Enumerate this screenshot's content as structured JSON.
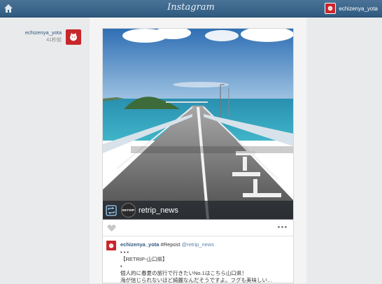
{
  "header": {
    "title": "Instagram",
    "username": "echizenya_yota"
  },
  "author": {
    "username": "echizenya_yota",
    "time": "41秒前"
  },
  "post": {
    "caption_account": "retrip_news",
    "logo_text": "RETRIP",
    "comment": {
      "username": "echizenya_yota",
      "tag": "#Repost",
      "mention": "@retrip_news",
      "lines": [
        "• • •",
        "【RETRIP-山口県】",
        "•",
        "個人的に春夏の旅行で行きたいNo.1はこちら山口県！",
        "海が信じられないほど綺麗なんだそうですよ。フグも美味しい…"
      ]
    }
  },
  "colors": {
    "topbar": "#2f5a80",
    "avatar": "#c8262b",
    "link": "#30587f"
  },
  "icons": [
    "home-icon",
    "repost-icon",
    "heart-icon",
    "more-icon"
  ]
}
